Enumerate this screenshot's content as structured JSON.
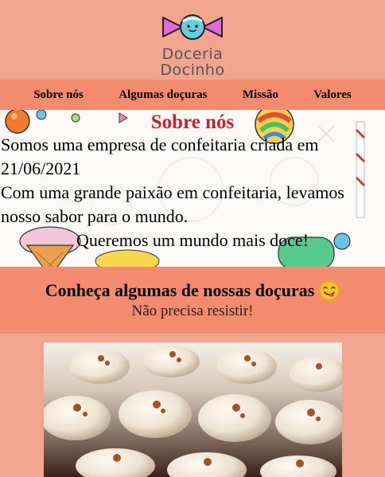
{
  "brand": {
    "name_line1": "Doceria",
    "name_line2": "Docinho",
    "logo_icon": "candy-icon"
  },
  "nav": {
    "items": [
      {
        "label": "Sobre nós"
      },
      {
        "label": "Algumas doçuras"
      },
      {
        "label": "Missão"
      },
      {
        "label": "Valores"
      }
    ]
  },
  "about": {
    "title": "Sobre nós",
    "line1": "Somos uma empresa de confeitaria criada em 21/06/2021",
    "line2": "Com uma grande paixão em confeitaria, levamos nosso sabor para o mundo.",
    "tagline": "Queremos um mundo mais doce!"
  },
  "sweets": {
    "heading": "Conheça algumas de nossas doçuras",
    "emoji": "smiling-face-savoring-food-emoji",
    "subheading": "Não precisa resistir!",
    "photo": "cupcakes-photo"
  },
  "colors": {
    "page_bg": "#f2a58e",
    "nav_bg": "#f48b6e",
    "title_red": "#c8202f"
  }
}
